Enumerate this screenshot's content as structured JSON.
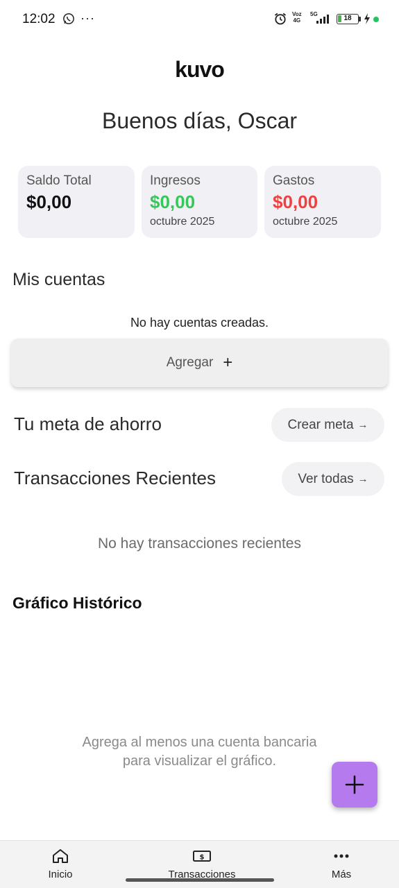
{
  "status_bar": {
    "time": "12:02",
    "more": "···",
    "volte_top": "Voz",
    "volte_bottom": "4G",
    "signal": "5G",
    "battery": "18",
    "icons": [
      "whatsapp-icon",
      "alarm-icon",
      "signal-icon",
      "battery-icon",
      "charging-icon"
    ]
  },
  "app": {
    "logo": "kuvo"
  },
  "greeting": "Buenos días, Oscar",
  "summary": {
    "total": {
      "label": "Saldo Total",
      "value": "$0,00"
    },
    "income": {
      "label": "Ingresos",
      "value": "$0,00",
      "period": "octubre 2025",
      "color": "#34c759"
    },
    "expenses": {
      "label": "Gastos",
      "value": "$0,00",
      "period": "octubre 2025",
      "color": "#f04040"
    }
  },
  "accounts": {
    "title": "Mis cuentas",
    "empty": "No hay cuentas creadas.",
    "add_label": "Agregar",
    "add_icon": "+"
  },
  "savings": {
    "title": "Tu meta de ahorro",
    "button": "Crear meta",
    "arrow": "→"
  },
  "transactions": {
    "title": "Transacciones Recientes",
    "button": "Ver todas",
    "arrow": "→",
    "empty": "No hay transacciones recientes"
  },
  "chart": {
    "title": "Gráfico Histórico",
    "empty_line1": "Agrega al menos una cuenta bancaria",
    "empty_line2": "para visualizar el gráfico."
  },
  "fab": {
    "icon": "plus-icon",
    "color": "#b57bee"
  },
  "nav": [
    {
      "label": "Inicio",
      "icon": "home-icon"
    },
    {
      "label": "Transacciones",
      "icon": "money-icon"
    },
    {
      "label": "Más",
      "icon": "more-icon"
    }
  ]
}
